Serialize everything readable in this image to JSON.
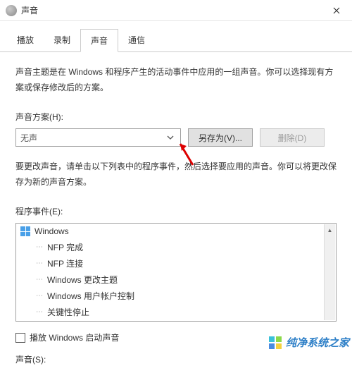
{
  "window": {
    "title": "声音",
    "close_tooltip": "Close"
  },
  "tabs": {
    "playback": "播放",
    "recording": "录制",
    "sounds": "声音",
    "communications": "通信"
  },
  "description": "声音主题是在 Windows 和程序产生的活动事件中应用的一组声音。你可以选择现有方案或保存修改后的方案。",
  "scheme": {
    "label": "声音方案(H):",
    "current": "无声",
    "save_as": "另存为(V)...",
    "delete": "删除(D)"
  },
  "events_desc": "要更改声音，请单击以下列表中的程序事件，然后选择要应用的声音。你可以将更改保存为新的声音方案。",
  "events": {
    "label": "程序事件(E):",
    "root": "Windows",
    "items": [
      "NFP 完成",
      "NFP 连接",
      "Windows 更改主题",
      "Windows 用户帐户控制",
      "关键性停止"
    ]
  },
  "play_startup": "播放 Windows 启动声音",
  "sounds_label": "声音(S):",
  "watermark": "纯净系统之家"
}
